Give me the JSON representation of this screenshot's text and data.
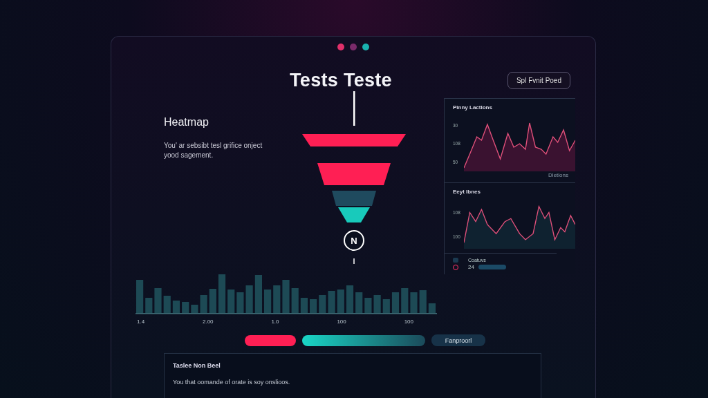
{
  "window": {
    "title": "Tests Teste",
    "action_button": "Spl Fvnit Poed"
  },
  "intro": {
    "heading": "Heatmap",
    "text": "You' ar sebsibt tesl grifice onject yood sagement."
  },
  "funnel": {
    "node_label": "N"
  },
  "side_panel": {
    "charts": [
      {
        "title": "Pinny Lactlons",
        "ticks": [
          "30",
          "108",
          "50"
        ],
        "footer": "Dletlons",
        "kind": "area"
      },
      {
        "title": "Eeyt lbnes",
        "ticks": [
          "108",
          "100"
        ],
        "kind": "line"
      }
    ],
    "legend": {
      "label": "Coatuvs",
      "value": "24"
    }
  },
  "bar_strip": {
    "labels": [
      "1.4",
      "2.00",
      "1.0",
      "100",
      "100"
    ]
  },
  "controls": {
    "button": "Fanproorl"
  },
  "card": {
    "title": "Taslee Non Beel",
    "lines": [
      "You that oomande of orate is soy onslioos."
    ]
  }
}
